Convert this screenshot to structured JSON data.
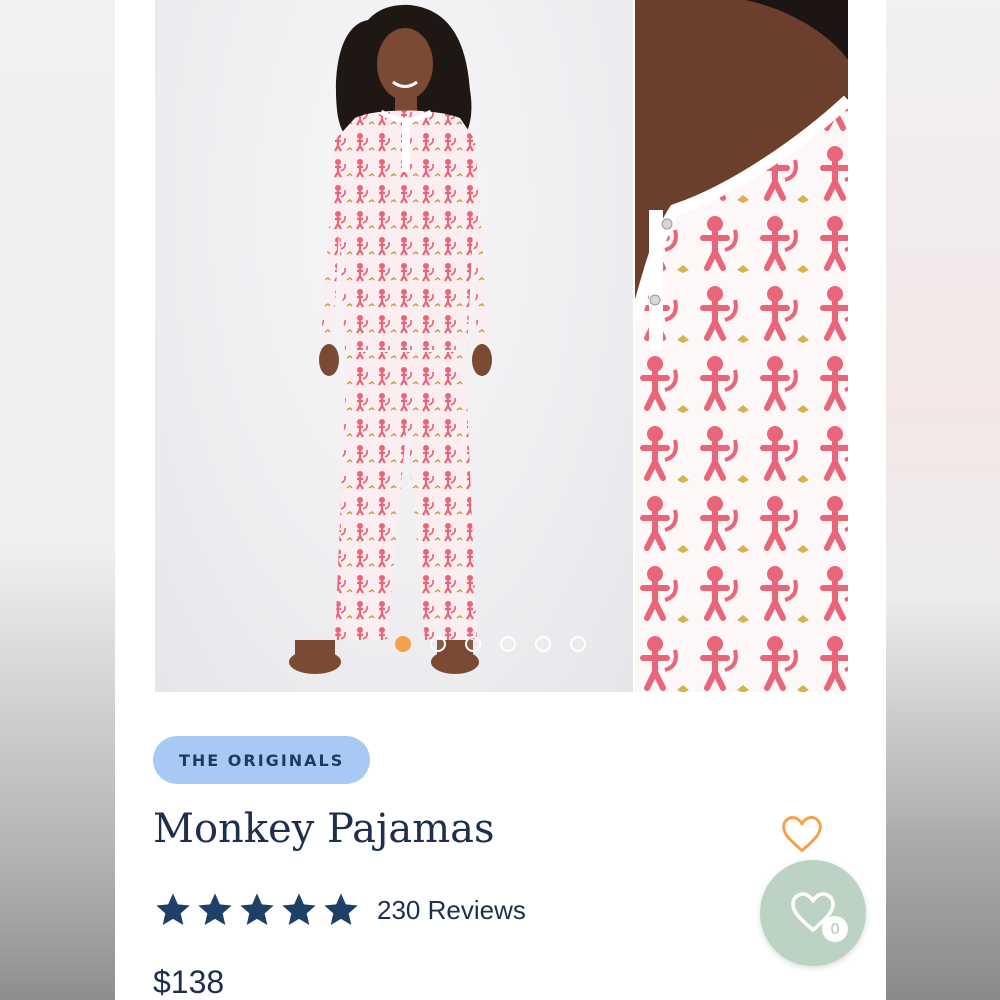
{
  "product": {
    "collection_badge": "THE ORIGINALS",
    "title": "Monkey Pajamas",
    "rating": 5,
    "rating_max": 5,
    "reviews_label": "230 Reviews",
    "price": "$138"
  },
  "gallery": {
    "images": [
      {
        "name": "model-full-length-photo"
      },
      {
        "name": "neckline-detail-photo"
      }
    ],
    "dot_count": 6,
    "active_index": 0
  },
  "wishlist": {
    "count": "0"
  },
  "colors": {
    "accent_orange": "#f5a04a",
    "badge_blue": "#a9c9f5",
    "navy_text": "#1e2f4d",
    "fab_green": "#bcd3c4",
    "monkey_pink": "#e8657a"
  },
  "icons": [
    "heart-outline-icon",
    "star-icon",
    "heart-icon"
  ]
}
